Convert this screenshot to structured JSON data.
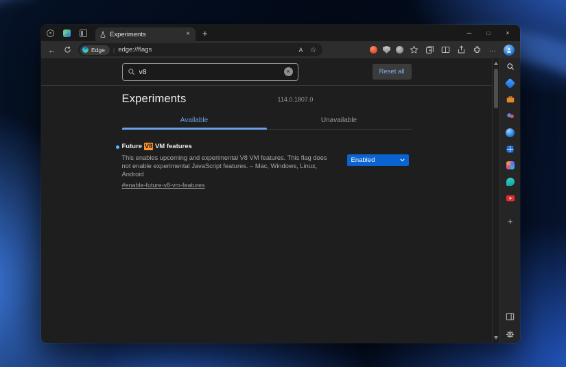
{
  "window": {
    "tab_title": "Experiments",
    "controls": {
      "minimize": "─",
      "maximize": "□",
      "close": "×"
    }
  },
  "tabstrip": {
    "new_tab_glyph": "+",
    "tab_close_glyph": "×"
  },
  "toolbar": {
    "back_glyph": "←",
    "brand": "Edge",
    "url": "edge://flags",
    "read_aloud_glyph": "A",
    "favorite_star_glyph": "☆",
    "more_glyph": "…"
  },
  "page": {
    "search_value": "v8",
    "clear_glyph": "×",
    "reset_button": "Reset all",
    "title": "Experiments",
    "version": "114.0.1807.0",
    "tab_available": "Available",
    "tab_unavailable": "Unavailable",
    "flag": {
      "name_pre": "Future ",
      "name_match": "V8",
      "name_post": " VM features",
      "description": "This enables upcoming and experimental V8 VM features. This flag does not enable experimental JavaScript features. – Mac, Windows, Linux, Android",
      "permalink": "#enable-future-v8-vm-features",
      "value": "Enabled"
    }
  },
  "sidebar": {
    "add_glyph": "+"
  },
  "scrollbar": {},
  "colors": {
    "accent_blue": "#67a3e6",
    "select_blue": "#0a63ce",
    "highlight_orange": "#ff9632",
    "modified_dot": "#4cc2ff"
  }
}
